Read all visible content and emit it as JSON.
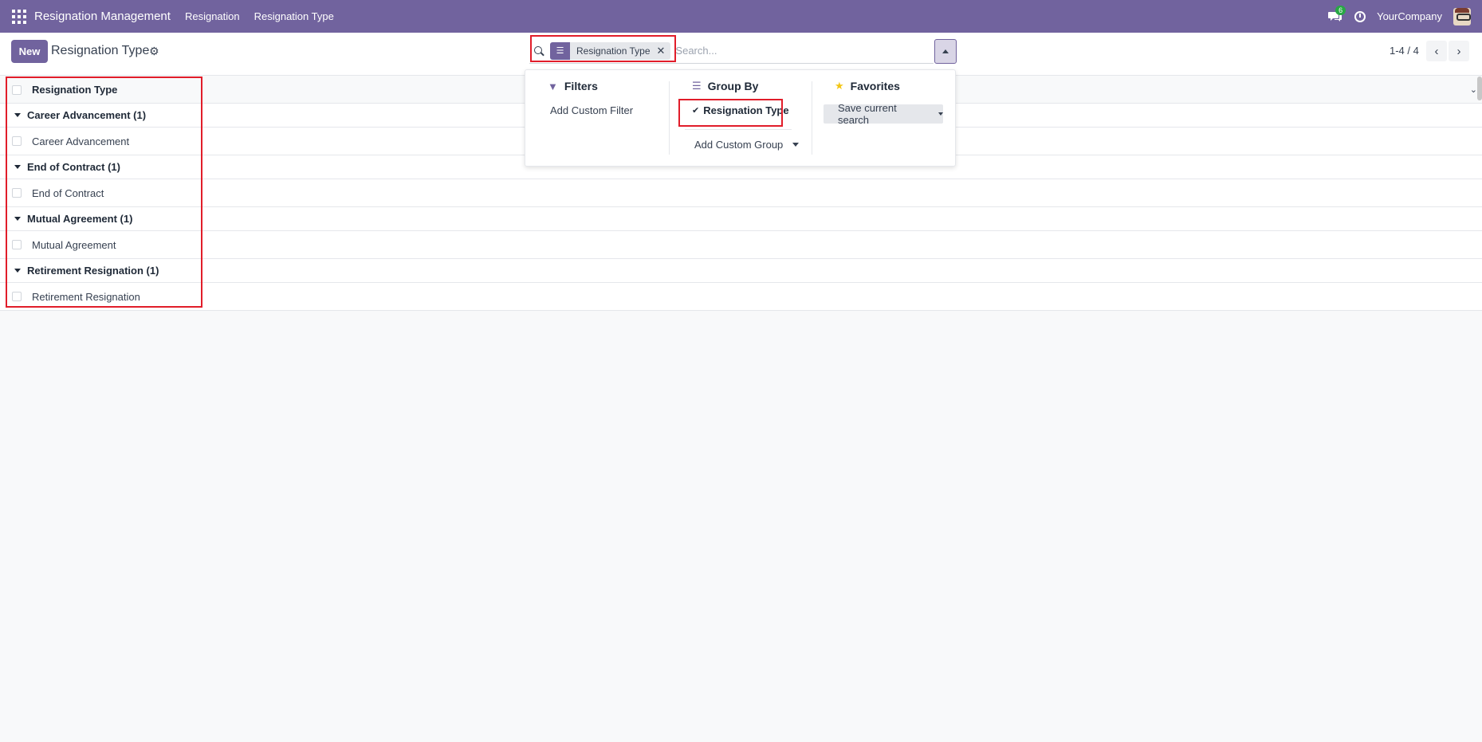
{
  "navbar": {
    "brand": "Resignation Management",
    "menus": [
      "Resignation",
      "Resignation Type"
    ],
    "chat_badge": "6",
    "company": "YourCompany"
  },
  "control": {
    "new_label": "New",
    "title": "Resignation Type",
    "facet_label": "Resignation Type",
    "search_placeholder": "Search...",
    "pager": "1-4 / 4"
  },
  "list": {
    "column_header": "Resignation Type",
    "groups": [
      {
        "label": "Career Advancement (1)",
        "record": "Career Advancement"
      },
      {
        "label": "End of Contract (1)",
        "record": "End of Contract"
      },
      {
        "label": "Mutual Agreement (1)",
        "record": "Mutual Agreement"
      },
      {
        "label": "Retirement Resignation (1)",
        "record": "Retirement Resignation"
      }
    ]
  },
  "dropdown": {
    "filters_title": "Filters",
    "add_custom_filter": "Add Custom Filter",
    "group_by_title": "Group By",
    "group_by_option": "Resignation Type",
    "add_custom_group": "Add Custom Group",
    "favorites_title": "Favorites",
    "save_current_search": "Save current search"
  },
  "colors": {
    "brand": "#71639e",
    "annotation": "#e11d2a",
    "badge": "#28a745"
  }
}
